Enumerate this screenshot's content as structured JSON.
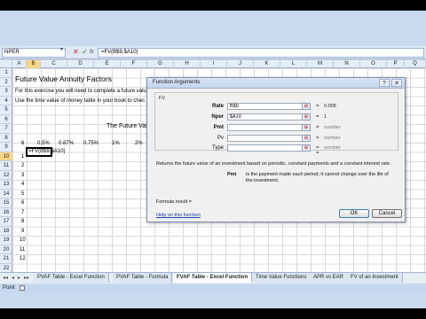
{
  "formula_bar": {
    "name_box": "NPER",
    "cancel_icon": "✕",
    "enter_icon": "✓",
    "fx_label": "fx",
    "formula": "=FV(B$9,$A10)"
  },
  "grid": {
    "columns": [
      "A",
      "B",
      "C",
      "D",
      "E",
      "F",
      "G",
      "H",
      "I",
      "J",
      "K",
      "L",
      "M",
      "N",
      "O",
      "P",
      "Q"
    ],
    "rows": [
      "1",
      "2",
      "3",
      "4",
      "5",
      "6",
      "7",
      "8",
      "9",
      "10",
      "11",
      "12",
      "13",
      "14",
      "15",
      "16",
      "17",
      "18",
      "19",
      "20",
      "21",
      "22"
    ],
    "cells": {
      "title": "Future Value Annuity Factors",
      "line3": "For this exercise you will need to complete a future valu",
      "line4": "Use the time value of money table in your book to chec",
      "table_title": "The Future Valu",
      "header_label": "6",
      "rate_headers": [
        "0.5%",
        "0.67%",
        "0.75%",
        "1%",
        "2%"
      ],
      "row_values": [
        "1",
        "2",
        "3",
        "4",
        "5",
        "6",
        "7",
        "8",
        "9",
        "10",
        "11",
        "12"
      ],
      "active_cell_text": "=FV(B$9,$A10)"
    }
  },
  "dialog": {
    "title": "Function Arguments",
    "help_icon": "?",
    "close_icon": "✕",
    "function_name": "FV",
    "args": [
      {
        "label": "Rate",
        "value": "B$9",
        "result": "0.005",
        "bold": true
      },
      {
        "label": "Nper",
        "value": "$A10",
        "result": "1",
        "bold": true
      },
      {
        "label": "Pmt",
        "value": "",
        "result": "number",
        "bold": true
      },
      {
        "label": "Pv",
        "value": "",
        "result": "number",
        "bold": false
      },
      {
        "label": "Type",
        "value": "",
        "result": "number",
        "bold": false
      }
    ],
    "equals": "=",
    "description": "Returns the future value of an investment based on periodic, constant payments and a constant interest rate.",
    "pmt_label": "Pmt",
    "pmt_description": "is the payment made each period; it cannot change over the life of the investment.",
    "formula_result": "Formula result =",
    "help_link": "Help on this function",
    "ok_label": "OK",
    "cancel_label": "Cancel"
  },
  "sheet_tabs": {
    "nav": [
      "◂◂",
      "◂",
      "▸",
      "▸▸"
    ],
    "tabs": [
      "PVAF Table - Excel Function",
      "PVAF Table - Formula",
      "FVAF Table - Excel Function",
      "Time Value Functions",
      "APR vs EAR",
      "FV of an Investment"
    ],
    "active_index": 2
  },
  "status_bar": {
    "mode": "Point"
  }
}
